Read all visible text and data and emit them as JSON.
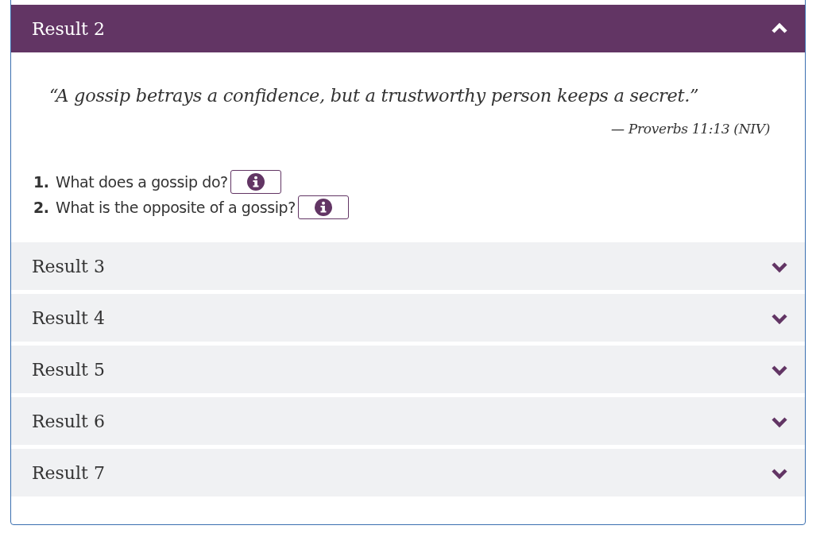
{
  "results": [
    {
      "title": "Result 2",
      "expanded": true,
      "quote": "“A gossip betrays a confidence, but a trustworthy person keeps a secret.”",
      "citation": "— Proverbs 11:13 (NIV)",
      "questions": [
        {
          "number": "1.",
          "text": "What does a gossip do?"
        },
        {
          "number": "2.",
          "text": "What is the opposite of a gossip?"
        }
      ]
    },
    {
      "title": "Result 3",
      "expanded": false
    },
    {
      "title": "Result 4",
      "expanded": false
    },
    {
      "title": "Result 5",
      "expanded": false
    },
    {
      "title": "Result 6",
      "expanded": false
    },
    {
      "title": "Result 7",
      "expanded": false
    }
  ]
}
